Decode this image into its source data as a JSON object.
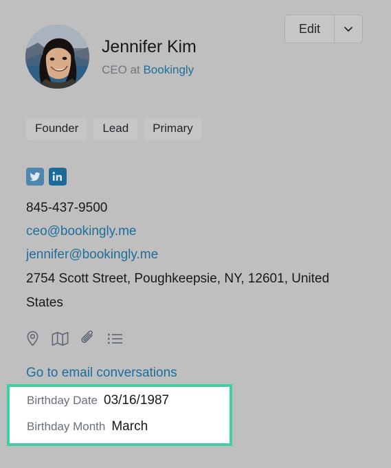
{
  "colors": {
    "page_background": "#bfbfbf",
    "link": "#1d6e9c",
    "highlight_border": "#3fcfa2",
    "highlight_fill": "#ffffff",
    "tag_background": "#c6c6c6",
    "twitter": "#4d87ad",
    "linkedin": "#1b6a99",
    "muted_text": "#6f757d",
    "primary_text": "#16181c"
  },
  "header": {
    "avatar_name": "contact-avatar",
    "name": "Jennifer Kim",
    "title_prefix": "CEO at ",
    "company": "Bookingly",
    "edit_label": "Edit",
    "edit_caret_icon": "chevron-down-icon"
  },
  "tags": [
    {
      "label": "Founder"
    },
    {
      "label": "Lead"
    },
    {
      "label": "Primary"
    }
  ],
  "social": [
    {
      "name": "twitter-icon",
      "label": "Twitter"
    },
    {
      "name": "linkedin-icon",
      "label": "LinkedIn"
    }
  ],
  "contact": {
    "phone": "845-437-9500",
    "email_primary": "ceo@bookingly.me",
    "email_secondary": "jennifer@bookingly.me",
    "address": "2754 Scott Street, Poughkeepsie, NY, 12601, United States"
  },
  "action_icons": [
    {
      "name": "location-pin-icon"
    },
    {
      "name": "map-icon"
    },
    {
      "name": "paperclip-icon"
    },
    {
      "name": "list-icon"
    }
  ],
  "links": {
    "email_conversations": "Go to email conversations"
  },
  "highlighted_fields": [
    {
      "label": "Birthday Date",
      "value": "03/16/1987"
    },
    {
      "label": "Birthday Month",
      "value": "March"
    }
  ]
}
